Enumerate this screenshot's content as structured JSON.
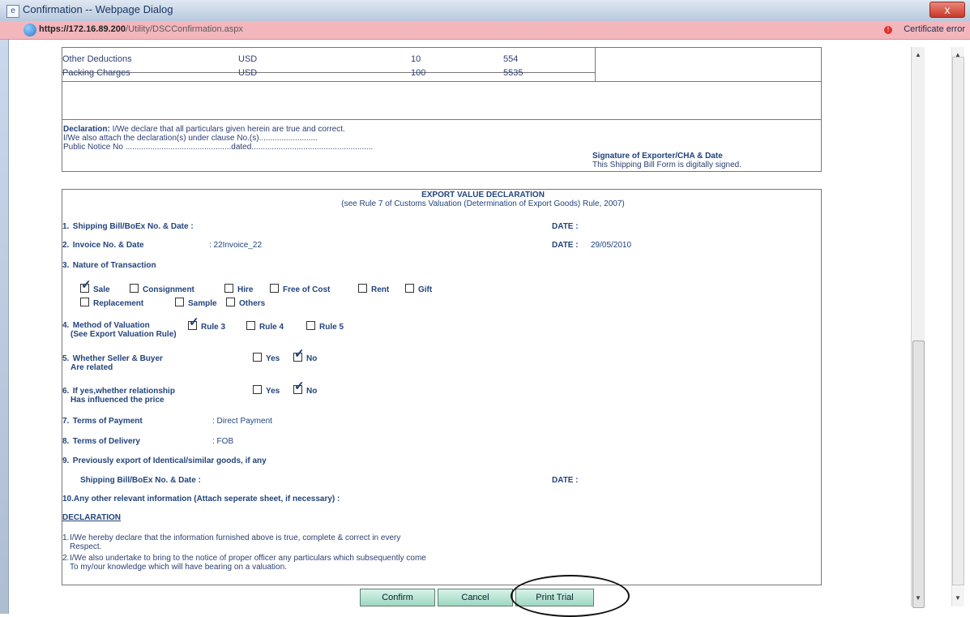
{
  "window": {
    "title": "Confirmation -- Webpage Dialog",
    "url_host": "https://172.16.89.200",
    "url_path": "/Utility/DSCConfirmation.aspx",
    "certificate_error": "Certificate error",
    "close_label": "x"
  },
  "charges_table": {
    "rows": [
      {
        "name": "Other Deductions",
        "currency": "USD",
        "rate": "10",
        "amount": "554"
      },
      {
        "name": "Packing Charges",
        "currency": "USD",
        "rate": "100",
        "amount": "5535"
      }
    ]
  },
  "declaration_top": {
    "label": "Declaration:",
    "line1": "I/We declare that all particulars given herein are true and correct.",
    "line2": "I/We also attach the declaration(s) under clause No.(s)..........................",
    "line3": "Public Notice No ...............................................dated......................................................"
  },
  "signature": {
    "title": "Signature of Exporter/CHA & Date",
    "note": "This Shipping Bill Form is digitally signed."
  },
  "evd": {
    "title": "EXPORT VALUE DECLARATION",
    "subtitle": "(see Rule 7 of Customs Valuation (Determination of Export Goods) Rule, 2007)",
    "item1": {
      "num": "1.",
      "label": "Shipping Bill/BoEx No. & Date  :",
      "date_label": "DATE :"
    },
    "item2": {
      "num": "2.",
      "label": "Invoice No. & Date",
      "value": ": 22Invoice_22",
      "date_label": "DATE :",
      "date_value": "29/05/2010"
    },
    "item3": {
      "num": "3.",
      "label": "Nature of Transaction"
    },
    "nature_options": [
      {
        "label": "Sale",
        "checked": true
      },
      {
        "label": "Consignment",
        "checked": false
      },
      {
        "label": "Hire",
        "checked": false
      },
      {
        "label": "Free of Cost",
        "checked": false
      },
      {
        "label": "Rent",
        "checked": false
      },
      {
        "label": "Gift",
        "checked": false
      },
      {
        "label": "Replacement",
        "checked": false
      },
      {
        "label": "Sample",
        "checked": false
      },
      {
        "label": "Others",
        "checked": false
      }
    ],
    "item4": {
      "num": "4.",
      "label": "Method of Valuation",
      "sub": "(See Export Valuation Rule)"
    },
    "valuation_options": [
      {
        "label": "Rule 3",
        "checked": true
      },
      {
        "label": "Rule 4",
        "checked": false
      },
      {
        "label": "Rule 5",
        "checked": false
      }
    ],
    "item5": {
      "num": "5.",
      "label": "Whether Seller & Buyer",
      "sub": "Are related",
      "yes": "Yes",
      "no": "No"
    },
    "item6": {
      "num": "6.",
      "label": "If yes,whether relationship",
      "sub": "Has influenced the price",
      "yes": "Yes",
      "no": "No"
    },
    "item7": {
      "num": "7.",
      "label": "Terms of Payment",
      "value": ": Direct Payment"
    },
    "item8": {
      "num": "8.",
      "label": "Terms of Delivery",
      "value": ": FOB"
    },
    "item9": {
      "num": "9.",
      "label": "Previously export of Identical/similar goods, if any"
    },
    "item9b": {
      "label": "Shipping Bill/BoEx No. & Date :",
      "date_label": "DATE :"
    },
    "item10": {
      "label": "10.Any other relevant information (Attach seperate sheet, if necessary) :"
    },
    "declaration_header": "DECLARATION",
    "decl1_num": "1.",
    "decl1_line1": "I/We hereby declare that the information furnished above is true, complete & correct in every",
    "decl1_line2": "Respect.",
    "decl2_num": "2.",
    "decl2_line1": "I/We also undertake to bring to the notice of proper officer any particulars which subsequently come",
    "decl2_line2": "To my/our knowledge which will have bearing on a valuation."
  },
  "buttons": {
    "confirm": "Confirm",
    "cancel": "Cancel",
    "print_trial": "Print Trial"
  },
  "colors": {
    "text_primary": "#1f3f7a",
    "button_bg": "#a8ddca",
    "address_bar": "#f4b6bd"
  },
  "icons": {
    "window_icon": "dialog-icon",
    "address_icon": "globe-icon",
    "cert_icon": "warning-icon"
  }
}
